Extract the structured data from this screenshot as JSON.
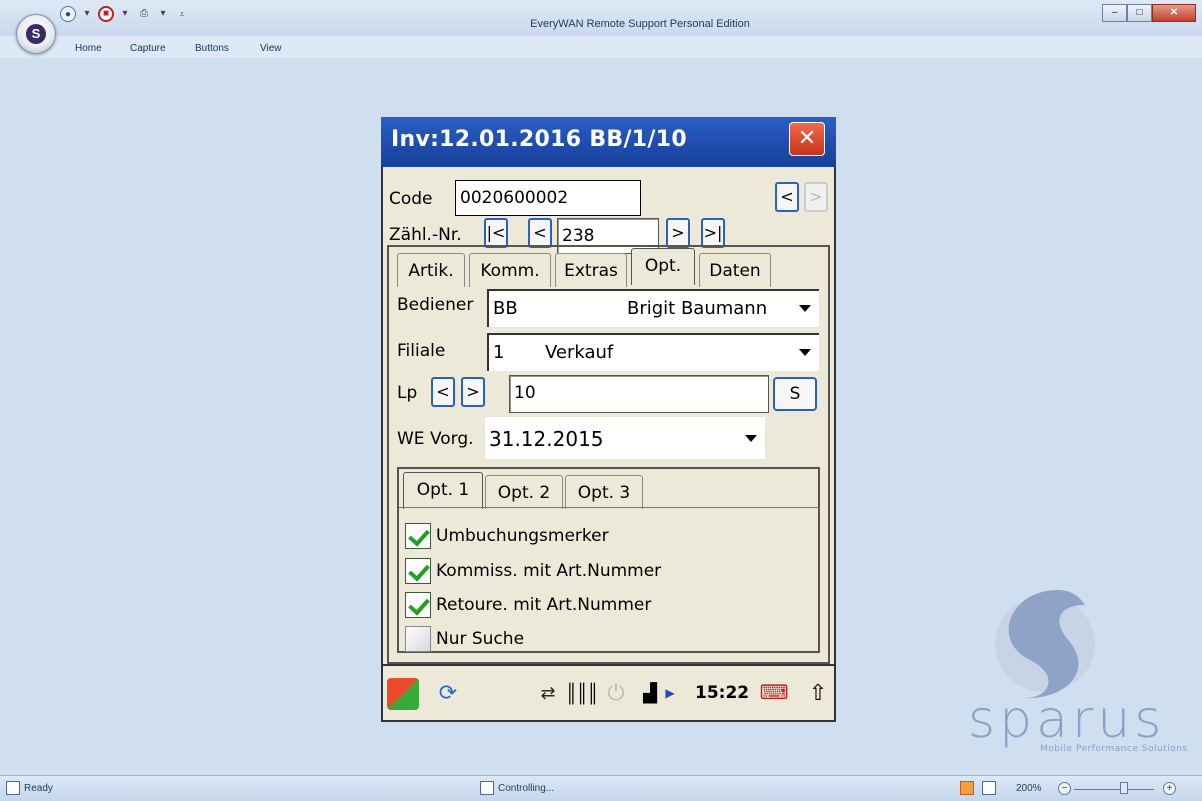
{
  "app": {
    "title": "EveryWAN Remote Support Personal Edition",
    "menu": [
      "Home",
      "Capture",
      "Buttons",
      "View"
    ],
    "window_controls": [
      "minimize",
      "maximize",
      "close"
    ]
  },
  "device": {
    "title": "Inv:12.01.2016 BB/1/10",
    "close_glyph": "✕",
    "code_label": "Code",
    "code_value": "0020600002",
    "code_prev": "<",
    "code_next": ">",
    "zaehl_label": "Zähl.-Nr.",
    "zaehl_first": "|<",
    "zaehl_prev": "<",
    "zaehl_value": "238",
    "zaehl_next": ">",
    "zaehl_last": ">|",
    "tabs": [
      "Artik.",
      "Komm.",
      "Extras",
      "Opt.",
      "Daten"
    ],
    "active_tab": "Opt.",
    "bediener_label": "Bediener",
    "bediener_code": "BB",
    "bediener_name": "Brigit Baumann",
    "filiale_label": "Filiale",
    "filiale_code": "1",
    "filiale_name": "Verkauf",
    "lp_label": "Lp",
    "lp_prev": "<",
    "lp_next": ">",
    "lp_value": "10",
    "lp_search": "S",
    "we_label": "WE Vorg.",
    "we_value": "31.12.2015",
    "subtabs": [
      "Opt. 1",
      "Opt. 2",
      "Opt. 3"
    ],
    "active_subtab": "Opt. 1",
    "options": [
      {
        "label": "Umbuchungsmerker",
        "checked": true
      },
      {
        "label": "Kommiss. mit Art.Nummer",
        "checked": true
      },
      {
        "label": "Retoure. mit Art.Nummer",
        "checked": true
      },
      {
        "label": "Nur Suche",
        "checked": false
      }
    ],
    "taskbar": {
      "clock": "15:22",
      "icons": [
        "windows-start-icon",
        "sync-icon",
        "scanner-icon",
        "barcode-icon",
        "power-icon",
        "signal-icon",
        "play-icon",
        "keyboard-icon",
        "up-arrow-icon"
      ]
    }
  },
  "branding": {
    "logo_word": "sparus",
    "logo_sub": "Mobile Performance Solutions",
    "accent": "#8aa0c6"
  },
  "statusbar": {
    "ready": "Ready",
    "controlling": "Controlling...",
    "zoom": "200%"
  },
  "colors": {
    "device_titlebar": "#2a5fc4",
    "device_close": "#c8341a",
    "device_body": "#ece9d8",
    "check": "#23a023",
    "workspace": "#cfdff0"
  }
}
